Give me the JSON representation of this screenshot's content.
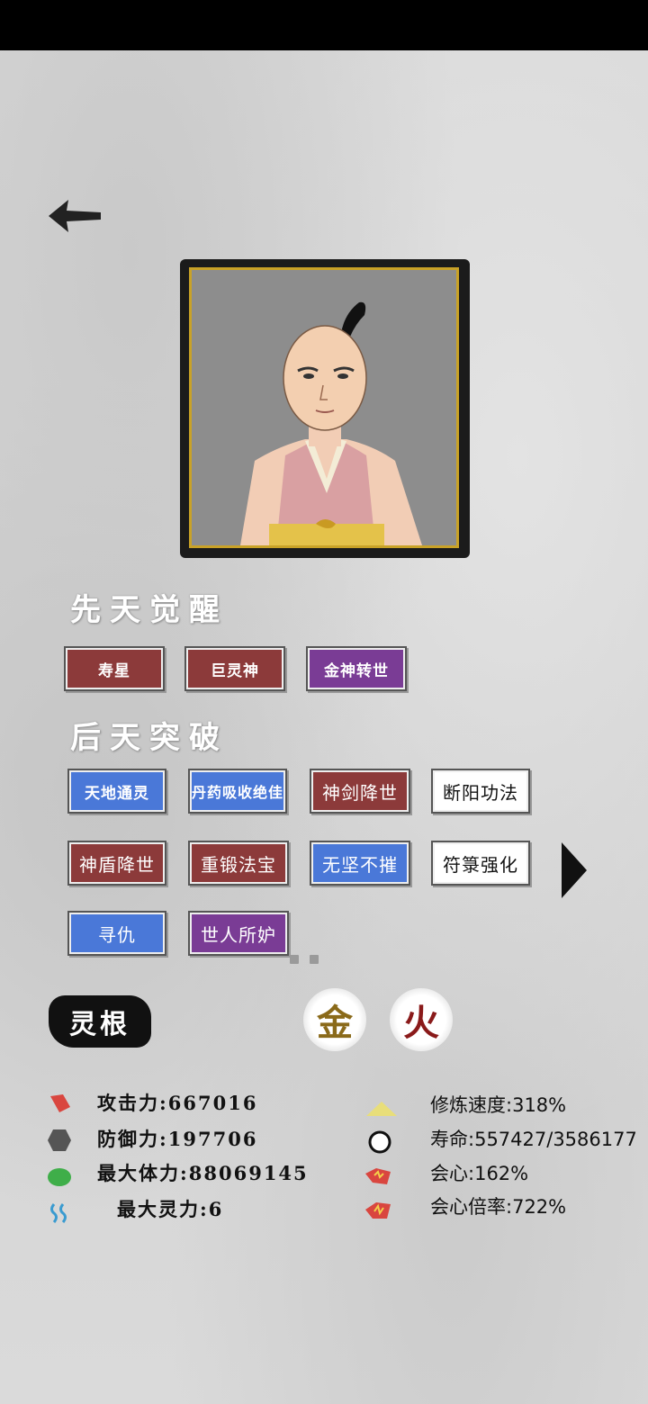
{
  "sections": {
    "innate_title": "先天觉醒",
    "acquired_title": "后天突破"
  },
  "innate_tags": [
    "寿星",
    "巨灵神",
    "金神转世"
  ],
  "acquired_tags": [
    "天地通灵",
    "丹药吸收绝佳",
    "神剑降世",
    "断阳功法",
    "神盾降世",
    "重锻法宝",
    "无坚不摧",
    "符箓强化",
    "寻仇",
    "世人所妒"
  ],
  "spirit_root": {
    "label": "灵根",
    "elements": [
      "金",
      "火"
    ]
  },
  "stats_left": [
    {
      "label": "攻击力",
      "value": "667016",
      "icon": "sword-tag-icon",
      "color": "#d9463f"
    },
    {
      "label": "防御力",
      "value": "197706",
      "icon": "shield-hexagon-icon",
      "color": "#555555"
    },
    {
      "label": "最大体力",
      "value": "88069145",
      "icon": "health-blob-icon",
      "color": "#3fae49"
    },
    {
      "label": "最大灵力",
      "value": "6",
      "icon": "spirit-wave-icon",
      "color": "#3a9bd0"
    }
  ],
  "stats_right": [
    {
      "label": "修炼速度",
      "value": "318%",
      "icon": "triangle-icon"
    },
    {
      "label": "寿命",
      "value": "557427/3586177",
      "icon": "circle-icon"
    },
    {
      "label": "会心",
      "value": "162%",
      "icon": "crit-icon"
    },
    {
      "label": "会心倍率",
      "value": "722%",
      "icon": "crit-multiplier-icon"
    }
  ],
  "colors": {
    "red_tag": "#8c3a3a",
    "purple_tag": "#7a3c95",
    "blue_tag": "#4a78d8",
    "gold": "#c9a227",
    "metal_element": "#8a6a1a",
    "fire_element": "#8a1a1a"
  }
}
